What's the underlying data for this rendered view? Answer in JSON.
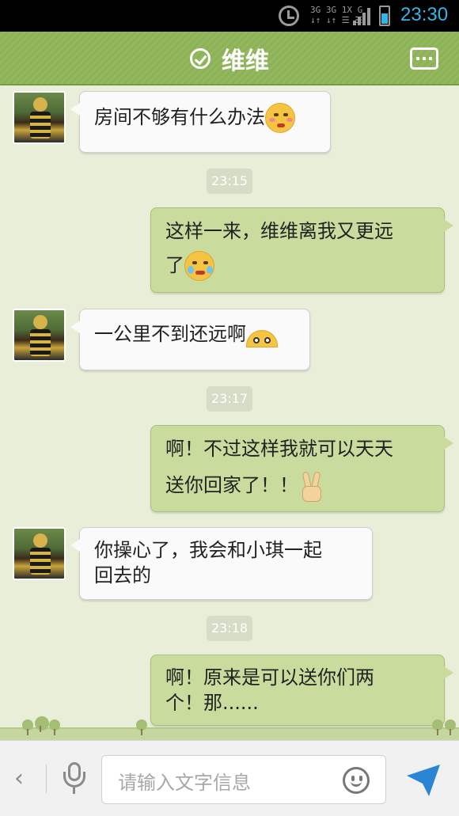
{
  "status_bar": {
    "network_line1": "3G 3G 1X G",
    "network_line2": "↓↑ ↓↑ ☰ ☰",
    "time": "23:30",
    "battery_color": "#33b5e5"
  },
  "header": {
    "title": "维维",
    "status_icon": "check-circle-icon",
    "menu_icon": "more-dots-icon",
    "bg_color": "#8db158"
  },
  "messages": [
    {
      "side": "left",
      "text": "房间不够有什么办法",
      "emoji": "shy-face-emoji"
    },
    {
      "type": "timestamp",
      "text": "23:15"
    },
    {
      "side": "right",
      "text_line1": "这样一来，维维离我又更远",
      "text_line2": "了",
      "emoji": "crying-face-emoji"
    },
    {
      "side": "left",
      "text": "一公里不到还远啊",
      "emoji": "peeking-face-emoji"
    },
    {
      "type": "timestamp",
      "text": "23:17"
    },
    {
      "side": "right",
      "text_line1": "啊！不过这样我就可以天天",
      "text_line2": "送你回家了！！",
      "emoji": "victory-hand-emoji"
    },
    {
      "side": "left",
      "text_line1": "你操心了，我会和小琪一起",
      "text_line2": "回去的"
    },
    {
      "type": "timestamp",
      "text": "23:18"
    },
    {
      "side": "right",
      "text_line1": "啊！原来是可以送你们两",
      "text_line2": "个！那......"
    }
  ],
  "input": {
    "placeholder": "请输入文字信息",
    "back_icon": "chevron-left-icon",
    "voice_icon": "microphone-icon",
    "emoji_icon": "smiley-icon",
    "send_icon": "send-icon",
    "send_color": "#2a86d4"
  },
  "colors": {
    "chat_bg": "#e9eed9",
    "bubble_out": "#c9dc9e",
    "bubble_in": "#fafafa"
  }
}
